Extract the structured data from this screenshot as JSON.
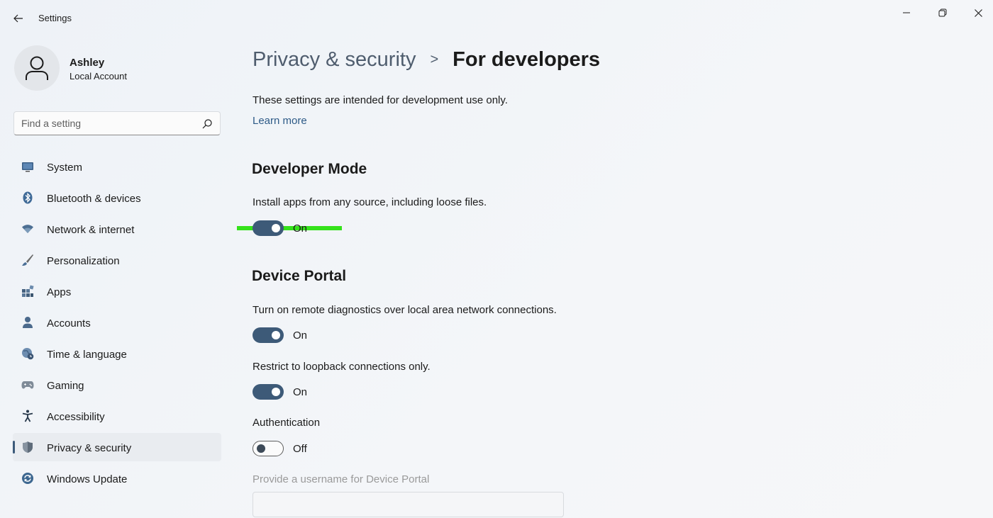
{
  "window": {
    "title": "Settings",
    "colors": {
      "accent": "#3d5a78",
      "highlight": "#35e21b",
      "link": "#2d5a87"
    }
  },
  "user": {
    "name": "Ashley",
    "account_type": "Local Account"
  },
  "search": {
    "placeholder": "Find a setting"
  },
  "sidebar": {
    "items": [
      {
        "label": "System",
        "icon": "monitor-icon",
        "active": false
      },
      {
        "label": "Bluetooth & devices",
        "icon": "bluetooth-icon",
        "active": false
      },
      {
        "label": "Network & internet",
        "icon": "wifi-icon",
        "active": false
      },
      {
        "label": "Personalization",
        "icon": "brush-icon",
        "active": false
      },
      {
        "label": "Apps",
        "icon": "apps-icon",
        "active": false
      },
      {
        "label": "Accounts",
        "icon": "person-icon",
        "active": false
      },
      {
        "label": "Time & language",
        "icon": "globe-clock-icon",
        "active": false
      },
      {
        "label": "Gaming",
        "icon": "gamepad-icon",
        "active": false
      },
      {
        "label": "Accessibility",
        "icon": "accessibility-icon",
        "active": false
      },
      {
        "label": "Privacy & security",
        "icon": "shield-icon",
        "active": true
      },
      {
        "label": "Windows Update",
        "icon": "update-icon",
        "active": false
      }
    ]
  },
  "main": {
    "breadcrumb_parent": "Privacy & security",
    "breadcrumb_separator": ">",
    "page_title": "For developers",
    "intro": "These settings are intended for development use only.",
    "learn_more": "Learn more",
    "developer_mode": {
      "title": "Developer Mode",
      "description": "Install apps from any source, including loose files.",
      "toggle_state": "On"
    },
    "device_portal": {
      "title": "Device Portal",
      "remote_description": "Turn on remote diagnostics over local area network connections.",
      "remote_state": "On",
      "loopback_description": "Restrict to loopback connections only.",
      "loopback_state": "On",
      "auth_label": "Authentication",
      "auth_state": "Off",
      "username_label": "Provide a username for Device Portal"
    }
  }
}
